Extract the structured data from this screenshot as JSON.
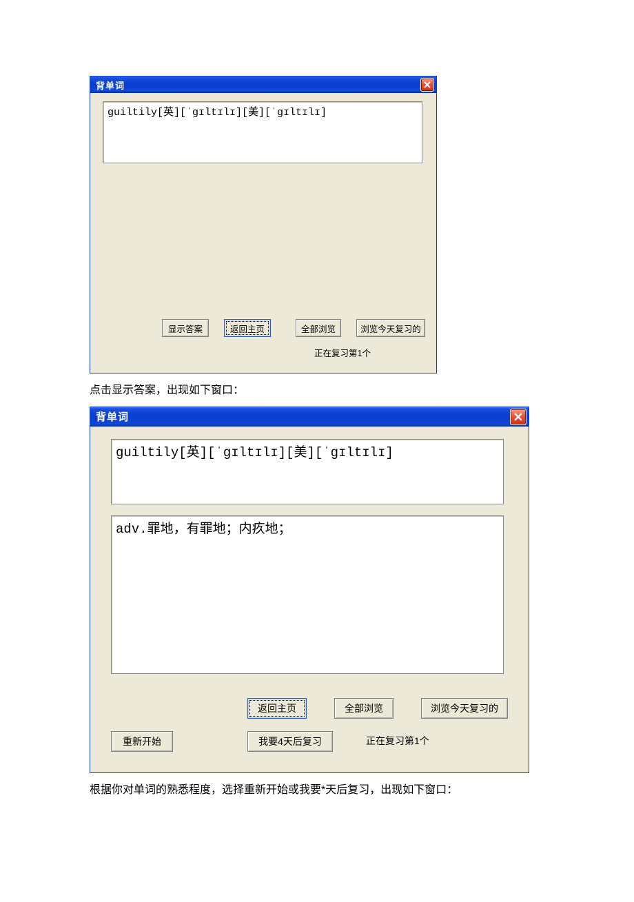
{
  "window1": {
    "title": "背单词",
    "question_text": "guiltily[英][ˈɡɪltɪlɪ][美][ˈɡɪltɪlɪ]",
    "buttons": {
      "show_answer": "显示答案",
      "back_home": "返回主页",
      "browse_all": "全部浏览",
      "browse_today": "浏览今天复习的"
    },
    "status": "正在复习第1个"
  },
  "caption1": "点击显示答案，出现如下窗口：",
  "window2": {
    "title": "背单词",
    "question_text": "guiltily[英][ˈɡɪltɪlɪ][美][ˈɡɪltɪlɪ]",
    "answer_text": "adv.罪地，有罪地；内疚地；",
    "buttons": {
      "back_home": "返回主页",
      "browse_all": "全部浏览",
      "browse_today": "浏览今天复习的",
      "restart": "重新开始",
      "review_later": "我要4天后复习"
    },
    "status": "正在复习第1个"
  },
  "caption2": "根据你对单词的熟悉程度，选择重新开始或我要*天后复习，出现如下窗口："
}
